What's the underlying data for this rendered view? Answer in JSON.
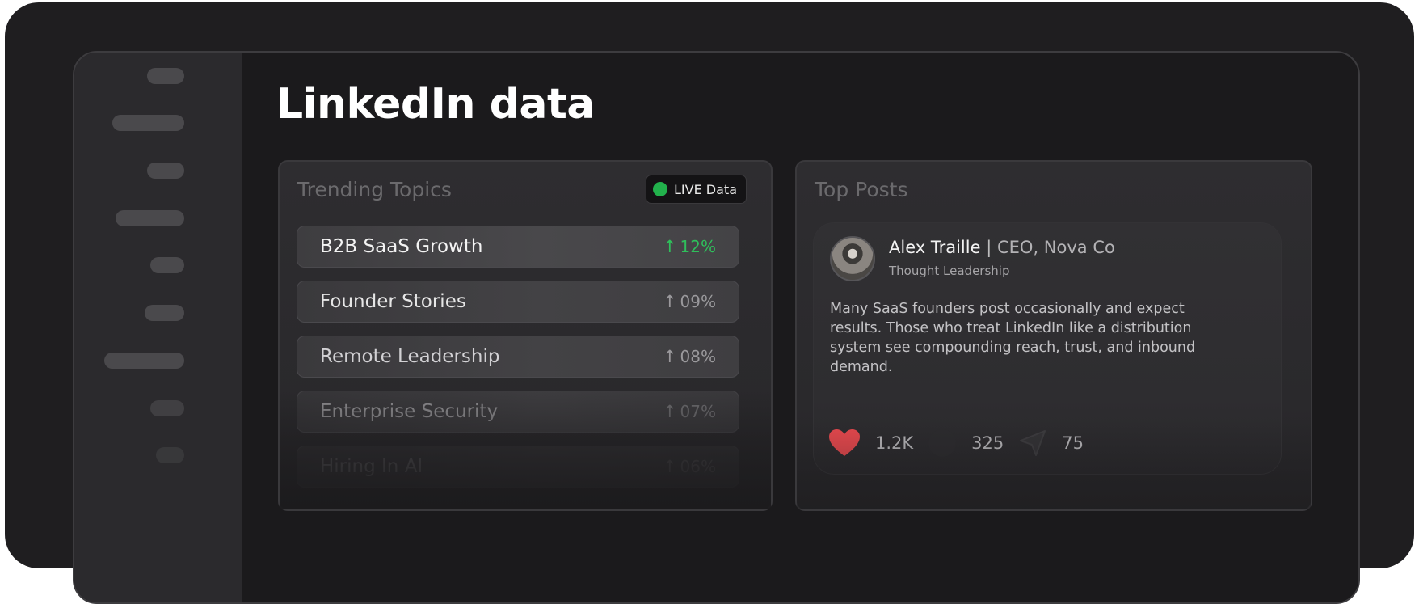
{
  "page": {
    "title": "LinkedIn data"
  },
  "trending": {
    "title": "Trending Topics",
    "live_label": "LIVE Data",
    "live_color": "#22b14c",
    "topics": [
      {
        "name": "B2B SaaS Growth",
        "change": "12%",
        "highlight": true
      },
      {
        "name": "Founder Stories",
        "change": "09%",
        "highlight": false
      },
      {
        "name": "Remote Leadership",
        "change": "08%",
        "highlight": false
      },
      {
        "name": "Enterprise Security",
        "change": "07%",
        "highlight": false
      },
      {
        "name": "Hiring In AI",
        "change": "06%",
        "highlight": false
      }
    ]
  },
  "top_posts": {
    "title": "Top Posts",
    "post": {
      "author": "Alex Traille",
      "separator": "|",
      "role": "CEO, Nova Co",
      "tag": "Thought Leadership",
      "body": "Many SaaS founders post occasionally and expect results. Those who treat LinkedIn like a distribution system see compounding reach, trust, and inbound demand.",
      "likes": "1.2K",
      "comments": "325",
      "shares": "75",
      "heart_color": "#e5484d"
    }
  },
  "icons": {
    "arrow_up": "↑"
  }
}
